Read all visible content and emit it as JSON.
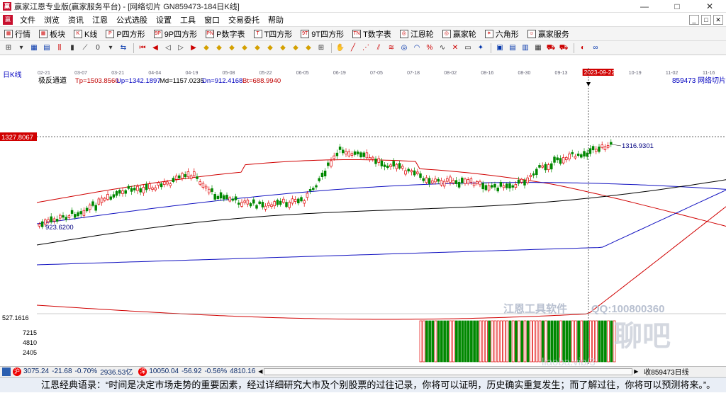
{
  "window": {
    "title": "赢家江恩专业版(赢家服务平台) - [网络切片  GN859473-184日K线]",
    "app_icon_text": "赢",
    "min": "—",
    "max": "□",
    "close": "✕"
  },
  "menu": {
    "items": [
      "文件",
      "浏览",
      "资讯",
      "江恩",
      "公式选股",
      "设置",
      "工具",
      "窗口",
      "交易委托",
      "帮助"
    ],
    "mdi": [
      "_",
      "□",
      "✕"
    ]
  },
  "toolbar1": {
    "items": [
      {
        "icon": "▦",
        "label": "行情"
      },
      {
        "icon": "▦",
        "label": "板块"
      },
      {
        "icon": "K",
        "label": "K线"
      },
      {
        "icon": "P",
        "label": "P四方形"
      },
      {
        "icon": "9P",
        "label": "9P四方形"
      },
      {
        "icon": "PN",
        "label": "P数字表"
      },
      {
        "icon": "T",
        "label": "T四方形"
      },
      {
        "icon": "9T",
        "label": "9T四方形"
      },
      {
        "icon": "TN",
        "label": "T数字表"
      },
      {
        "icon": "◎",
        "label": "江恩轮"
      },
      {
        "icon": "◎",
        "label": "赢家轮"
      },
      {
        "icon": "✶",
        "label": "六角形"
      },
      {
        "icon": "☺",
        "label": "赢家服务"
      }
    ]
  },
  "chart": {
    "indicator_name": "极反通道",
    "tp_label": "Tp=1503.8560",
    "up_label": "Up=1342.1897",
    "md_label": "Md=1157.0235",
    "dn_label": "Dn=912.4168",
    "bt_label": "Bt=688.9940",
    "code_label": "859473",
    "name_label": "网络切片",
    "period_label": "日K线",
    "price_cursor_label": "1327.8067",
    "high_mark": "1316.9301",
    "low_mark": "923.6200",
    "cursor_date": "2023-09-22",
    "vol_label_top": "527.1616",
    "vol_ticks": [
      "7215",
      "4810",
      "2405"
    ],
    "watermark_company": "江恩工具软件",
    "watermark_qq": "QQ:100800360",
    "watermark_site": "聊吧",
    "watermark_url": "liaoba.vip/3",
    "colors": {
      "up": "#e00000",
      "down": "#008800",
      "red_band": "#d00000",
      "blue_band": "#1010c0",
      "mid": "#000000"
    }
  },
  "date_axis": [
    "02-21",
    "03-07",
    "03-21",
    "04-04",
    "04-19",
    "05-08",
    "05-22",
    "06-05",
    "06-19",
    "07-05",
    "07-18",
    "08-02",
    "08-16",
    "08-30",
    "09-13",
    "2023-09-22",
    "10-19",
    "11-02",
    "11-16"
  ],
  "status": {
    "sh_icon": "沪",
    "sh_value": "3075.24",
    "sh_change": "-21.68",
    "sh_pct": "-0.70%",
    "sh_amount": "2936.53亿",
    "sz_icon": "深",
    "sz_value": "10050.04",
    "sz_change": "-56.92",
    "sz_pct": "-0.56%",
    "sz_amount": "4810.16",
    "right_label": "收859473日线"
  },
  "quote": {
    "text": "江恩经典语录：“时间是决定市场走势的重要因素，经过详细研究大市及个别股票的过往记录，你将可以证明，历史确实重复发生；而了解过往，你将可以预测将来。”。"
  }
}
